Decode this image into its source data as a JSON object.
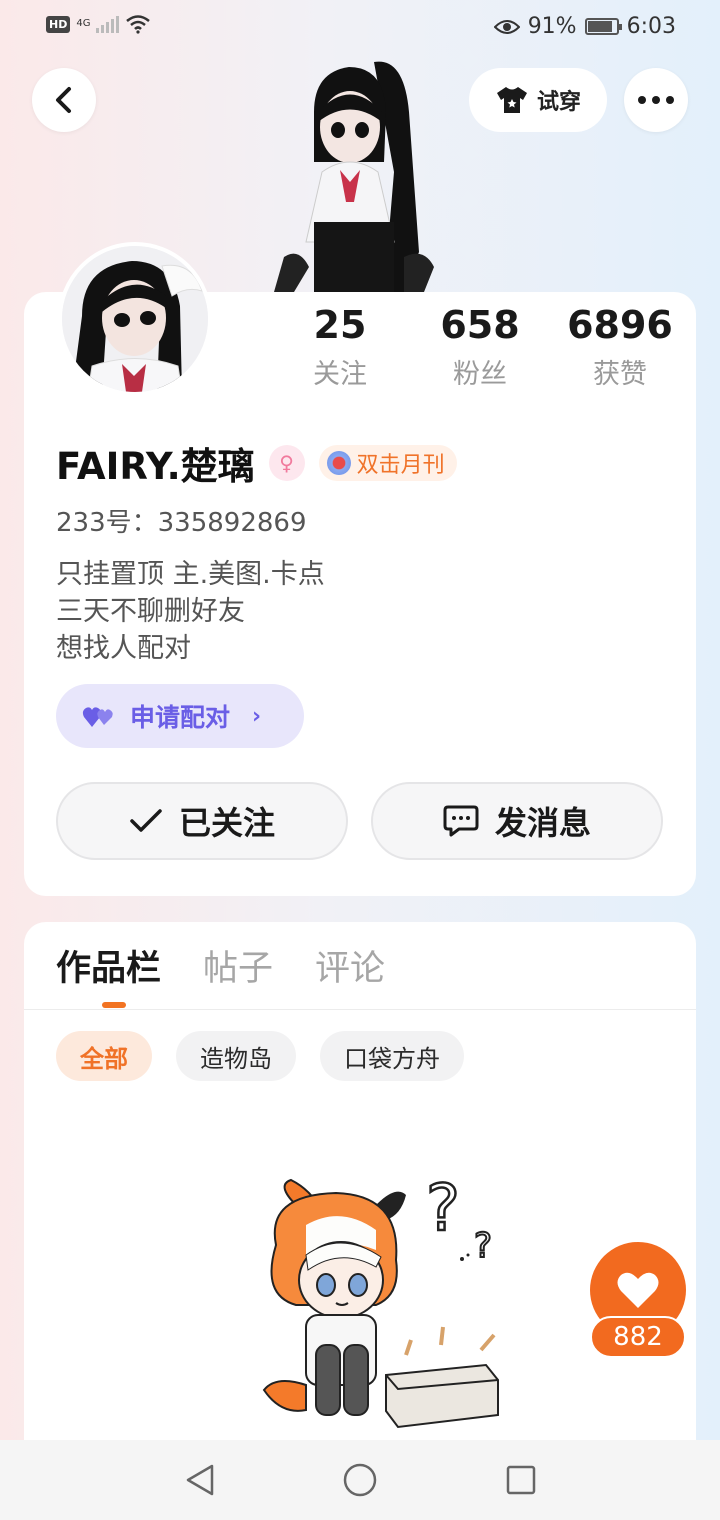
{
  "status_bar": {
    "hd": "HD",
    "network": "4G",
    "battery_percent": "91%",
    "time": "6:03",
    "battery_level": 0.91
  },
  "top_bar": {
    "back_icon": "chevron-left-icon",
    "try_on_label": "试穿",
    "try_on_icon": "shirt-icon",
    "more_icon": "more-dots-icon"
  },
  "profile": {
    "stats": [
      {
        "value": "25",
        "label": "关注"
      },
      {
        "value": "658",
        "label": "粉丝"
      },
      {
        "value": "6896",
        "label": "获赞"
      }
    ],
    "name": "FAIRY.楚璃",
    "gender_icon": "female-icon",
    "badge_label": "双击月刊",
    "uid": "233号：335892869",
    "bio_lines": [
      "只挂置顶 主.美图.卡点",
      "三天不聊删好友",
      "想找人配对"
    ],
    "pair_button": "申请配对",
    "follow_button": "已关注",
    "message_button": "发消息"
  },
  "works": {
    "tabs": [
      "作品栏",
      "帖子",
      "评论"
    ],
    "active_tab": 0,
    "chips": [
      "全部",
      "造物岛",
      "口袋方舟"
    ],
    "active_chip": 0
  },
  "like_fab": {
    "count": "882"
  },
  "colors": {
    "accent_orange": "#f26a1f",
    "pair_purple": "#6a5ee6"
  }
}
